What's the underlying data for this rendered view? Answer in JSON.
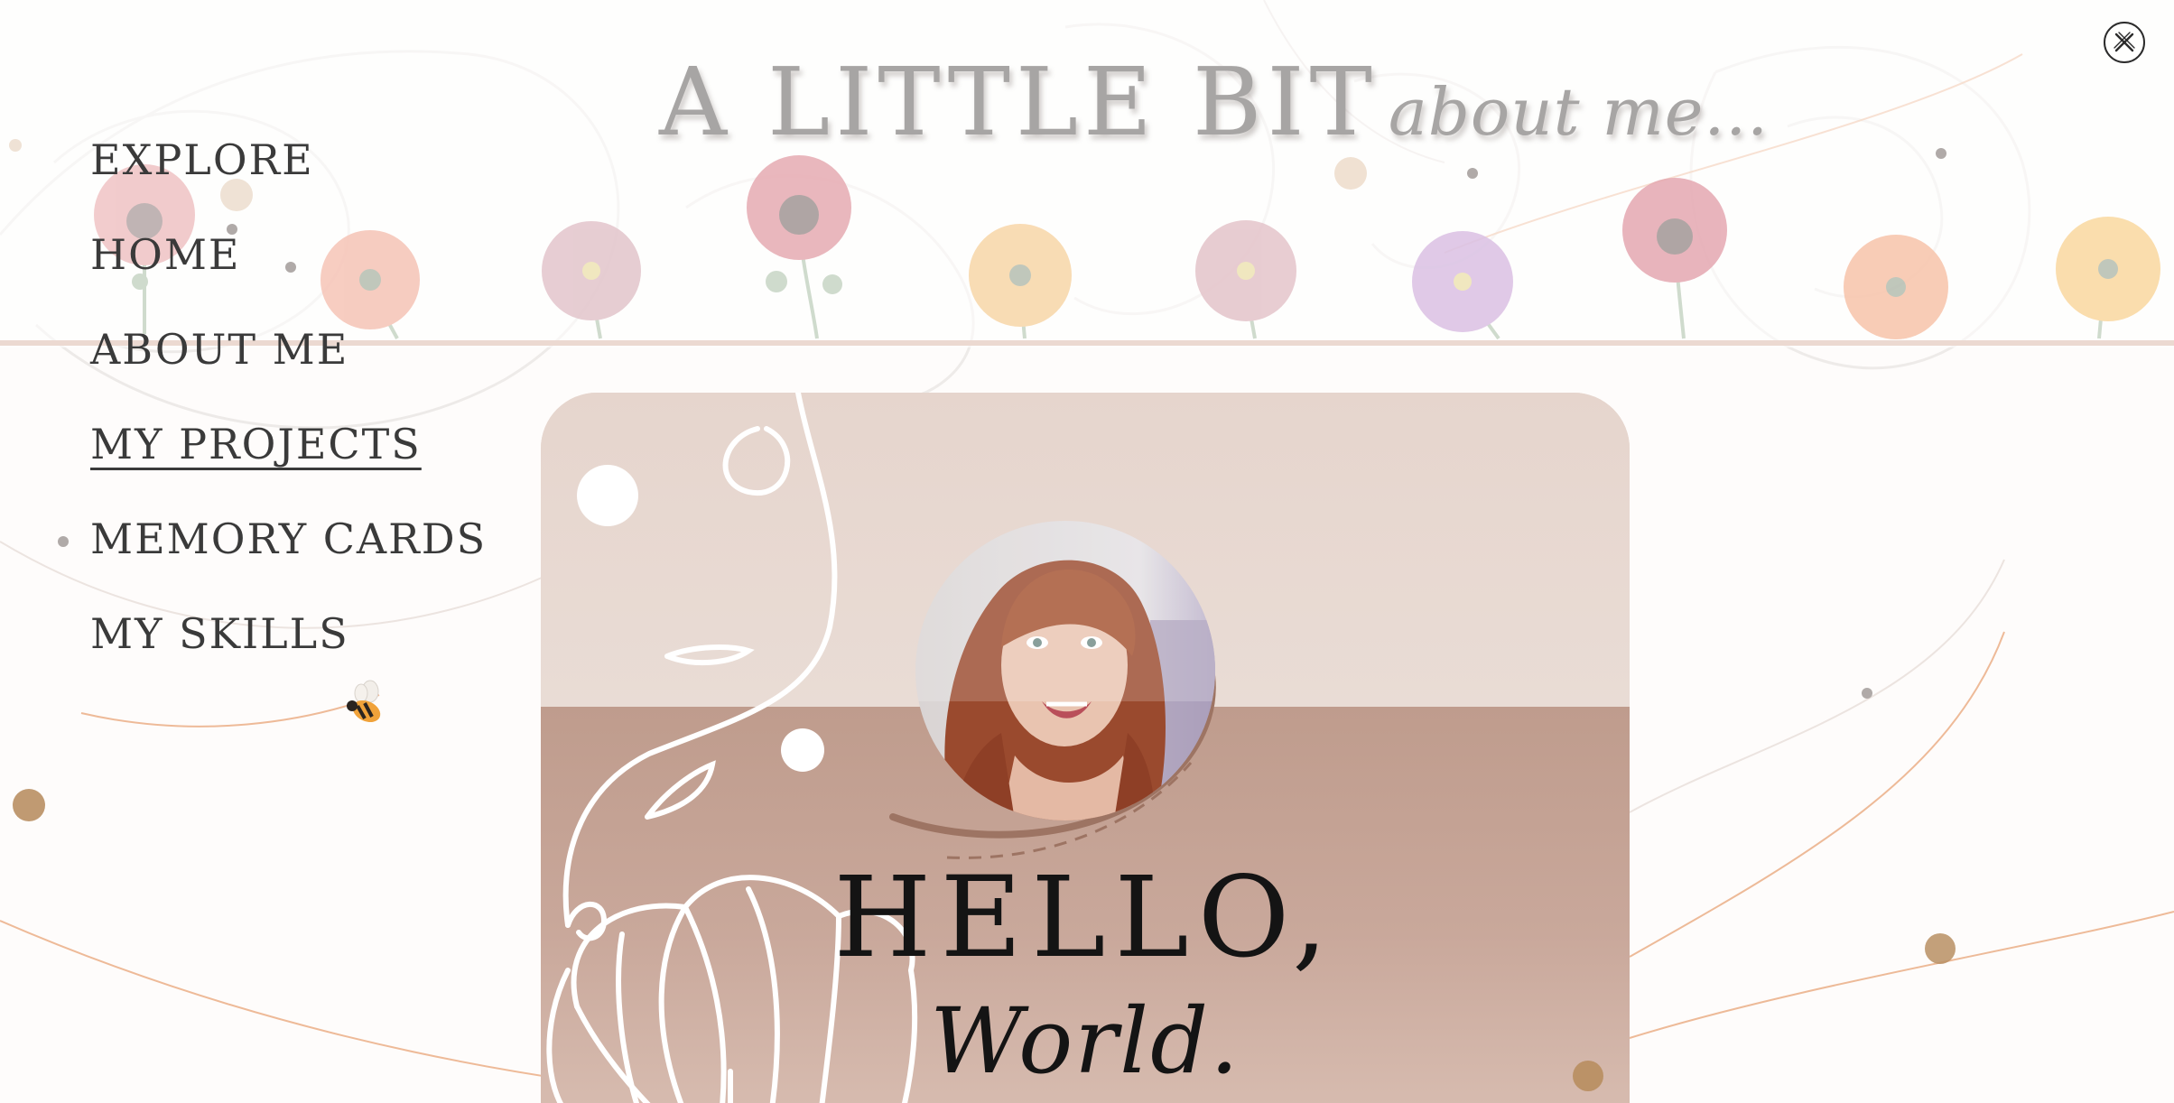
{
  "header": {
    "title_caps": "A LITTLE BIT",
    "title_script": "about me..."
  },
  "close_button": {
    "icon": "close-icon",
    "label": "Close menu"
  },
  "nav": {
    "items": [
      {
        "label": "EXPLORE",
        "active": false
      },
      {
        "label": "HOME",
        "active": false
      },
      {
        "label": "ABOUT ME",
        "active": false
      },
      {
        "label": "MY PROJECTS",
        "active": true
      },
      {
        "label": "MEMORY CARDS",
        "active": false
      },
      {
        "label": "MY SKILLS",
        "active": false
      }
    ]
  },
  "hero": {
    "greeting": "HELLO,",
    "subtitle": "World."
  },
  "colors": {
    "card_top": "#e6d5cd",
    "card_bottom": "#bf9c8d",
    "title_gray": "#a7a5a4",
    "nav_text": "#3a3a3a",
    "accent_gold": "#b98f63",
    "line_orange": "#e8a477"
  }
}
